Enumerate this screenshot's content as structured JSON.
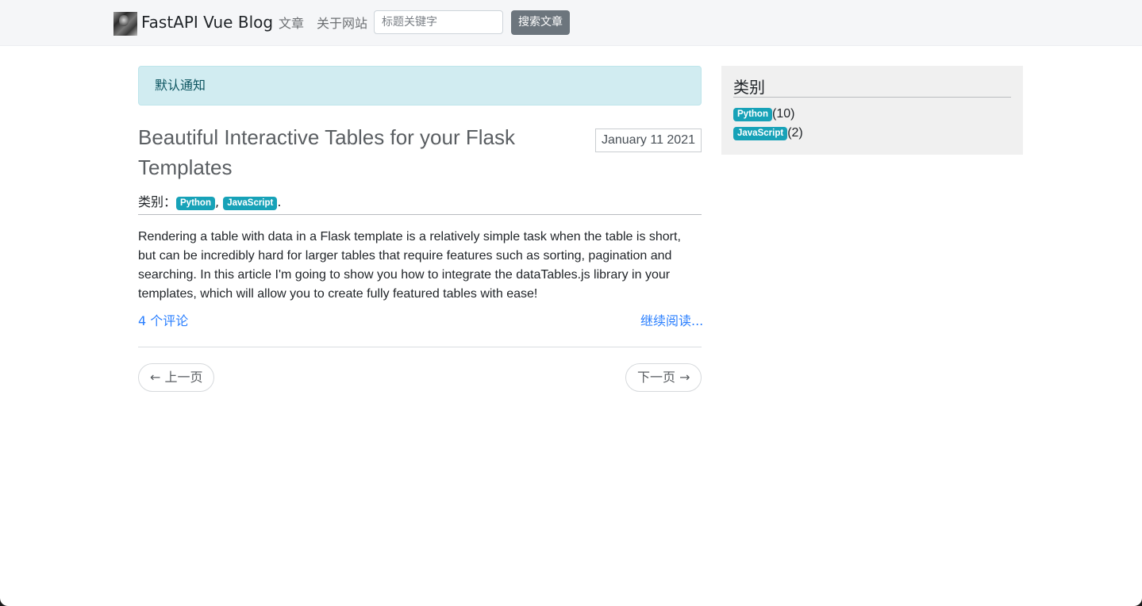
{
  "nav": {
    "brand": "FastAPI Vue Blog",
    "links": [
      "文章",
      "关于网站"
    ],
    "search_placeholder": "标题关键字",
    "search_button": "搜索文章"
  },
  "alert": {
    "text": "默认通知"
  },
  "post": {
    "title": "Beautiful Interactive Tables for your Flask Templates",
    "date": "January 11 2021",
    "category_label": "类别：",
    "categories": [
      "Python",
      "JavaScript"
    ],
    "separator": ",",
    "end": ".",
    "body": "Rendering a table with data in a Flask template is a relatively simple task when the table is short, but can be incredibly hard for larger tables that require features such as sorting, pagination and searching. In this article I'm going to show you how to integrate the dataTables.js library in your templates, which will allow you to create fully featured tables with ease!",
    "comments": "4 个评论",
    "read_more": "继续阅读..."
  },
  "pager": {
    "prev": "← 上一页",
    "next": "下一页 →"
  },
  "sidebar": {
    "title": "类别",
    "items": [
      {
        "name": "Python",
        "count": "(10)"
      },
      {
        "name": "JavaScript",
        "count": "(2)"
      }
    ]
  },
  "colors": {
    "badge": "#17a2b8",
    "link": "#2a7fff",
    "alert_bg": "#d1ecf1",
    "navbar_bg": "#f5f6f8",
    "search_button_bg": "#6c757d"
  }
}
